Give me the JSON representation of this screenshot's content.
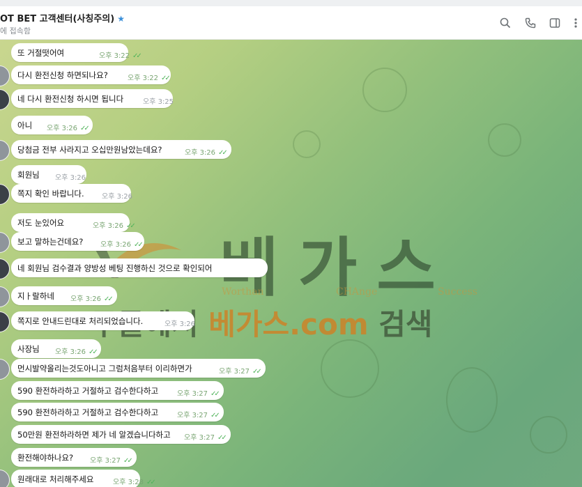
{
  "header": {
    "title": "OT BET 고객센터(사칭주의)",
    "subtitle": "에 접속함"
  },
  "watermark": {
    "brand": "베가스",
    "tag_left": "Worthan",
    "tag_mid": "CHAnge",
    "tag_right": "Success",
    "search_prefix": "구글에서 ",
    "search_highlight": "베가스.com",
    "search_suffix": " 검색"
  },
  "messages": [
    {
      "text": "또 거절떳어여",
      "time": "오후 3:22",
      "read": true
    },
    {
      "text": "다시 환전신청 하면되나요?",
      "time": "오후 3:22",
      "read": true
    },
    {
      "text": "네 다시 환전신청 하시면 됩니다",
      "time": "오후 3:25",
      "read": false
    },
    {
      "text": "아니",
      "time": "오후 3:26",
      "read": true
    },
    {
      "text": "당첨금 전부 사라지고 오십만원남았는데요?",
      "time": "오후 3:26",
      "read": true
    },
    {
      "text": "회원님",
      "time": "오후 3:26",
      "read": false
    },
    {
      "text": "쪽지 확인 바랍니다.",
      "time": "오후 3:26",
      "read": false
    },
    {
      "text": "저도 눈있어요",
      "time": "오후 3:26",
      "read": true
    },
    {
      "text": "보고 말하는건데요?",
      "time": "오후 3:26",
      "read": true
    },
    {
      "text": "네 회원님 검수결과 양방성 베팅 진행하신 것으로 확인되어",
      "time": "",
      "read": false
    },
    {
      "text": "지ㅏ랄하네",
      "time": "오후 3:26",
      "read": true
    },
    {
      "text": "쪽지로 안내드린대로 처리되었습니다.",
      "time": "오후 3:26",
      "read": false
    },
    {
      "text": "사장님",
      "time": "오후 3:26",
      "read": true
    },
    {
      "text": "먼시발약올리는것도아니고 그럼처음부터 이리하면가",
      "time": "오후 3:27",
      "read": true
    },
    {
      "text": "590 환전하라하고 거절하고 검수한다하고",
      "time": "오후 3:27",
      "read": true
    },
    {
      "text": "590 환전하라하고 거절하고 검수한다하고",
      "time": "오후 3:27",
      "read": true
    },
    {
      "text": "50만원 환전하라하면 제가 네 알겠습니다하고",
      "time": "오후 3:27",
      "read": true
    },
    {
      "text": "환전해야하나요?",
      "time": "오후 3:27",
      "read": true
    },
    {
      "text": "원래대로 처리해주세요",
      "time": "오후 3:28",
      "read": true
    }
  ],
  "icons": [
    "search-icon",
    "phone-icon",
    "sidebar-toggle-icon",
    "more-icon",
    "star-icon"
  ]
}
